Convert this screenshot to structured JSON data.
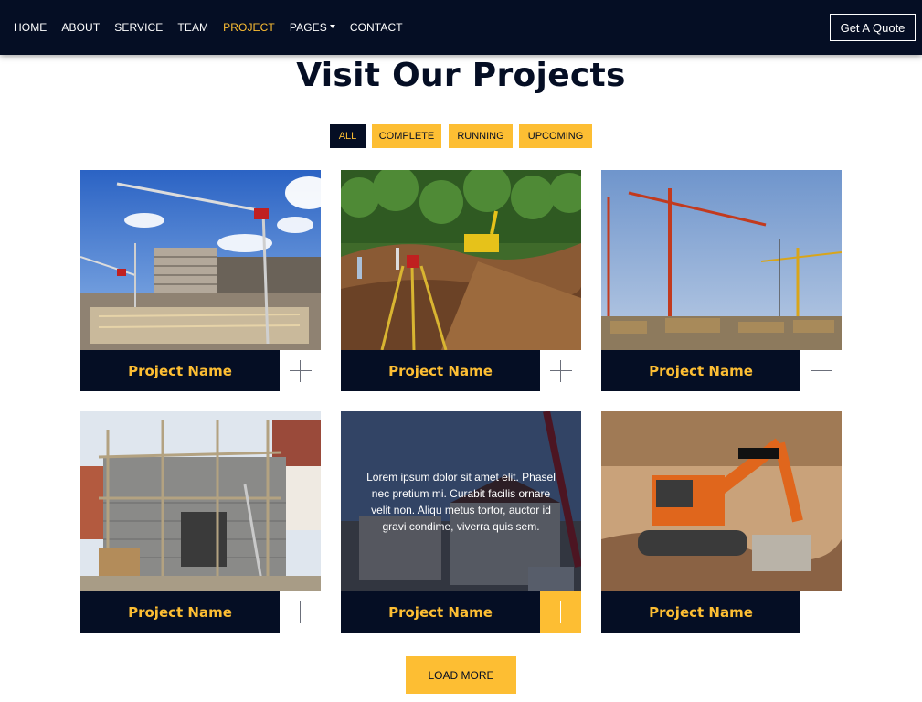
{
  "nav": {
    "items": [
      {
        "label": "HOME"
      },
      {
        "label": "ABOUT"
      },
      {
        "label": "SERVICE"
      },
      {
        "label": "TEAM"
      },
      {
        "label": "PROJECT",
        "active": true
      },
      {
        "label": "PAGES",
        "dropdown": true
      },
      {
        "label": "CONTACT"
      }
    ],
    "cta_label": "Get A Quote"
  },
  "section": {
    "title": "Visit Our Projects"
  },
  "filters": [
    {
      "label": "ALL",
      "active": true
    },
    {
      "label": "COMPLETE"
    },
    {
      "label": "RUNNING"
    },
    {
      "label": "UPCOMING"
    }
  ],
  "projects": [
    {
      "name": "Project Name",
      "image": "tower-crane-building-site-photo"
    },
    {
      "name": "Project Name",
      "image": "surveyor-tripod-excavator-forest-photo"
    },
    {
      "name": "Project Name",
      "image": "tower-cranes-blue-sky-photo"
    },
    {
      "name": "Project Name",
      "image": "house-scaffolding-photo"
    },
    {
      "name": "Project Name",
      "image": "house-crane-photo",
      "overlay_text": "Lorem ipsum dolor sit amet elit. Phasel nec pretium mi. Curabit facilis ornare velit non. Aliqu metus tortor, auctor id gravi condime, viverra quis sem."
    },
    {
      "name": "Project Name",
      "image": "orange-excavator-photo"
    }
  ],
  "load_more_label": "Load More",
  "colors": {
    "navy": "#050e24",
    "accent": "#fdbe33",
    "white": "#ffffff"
  }
}
